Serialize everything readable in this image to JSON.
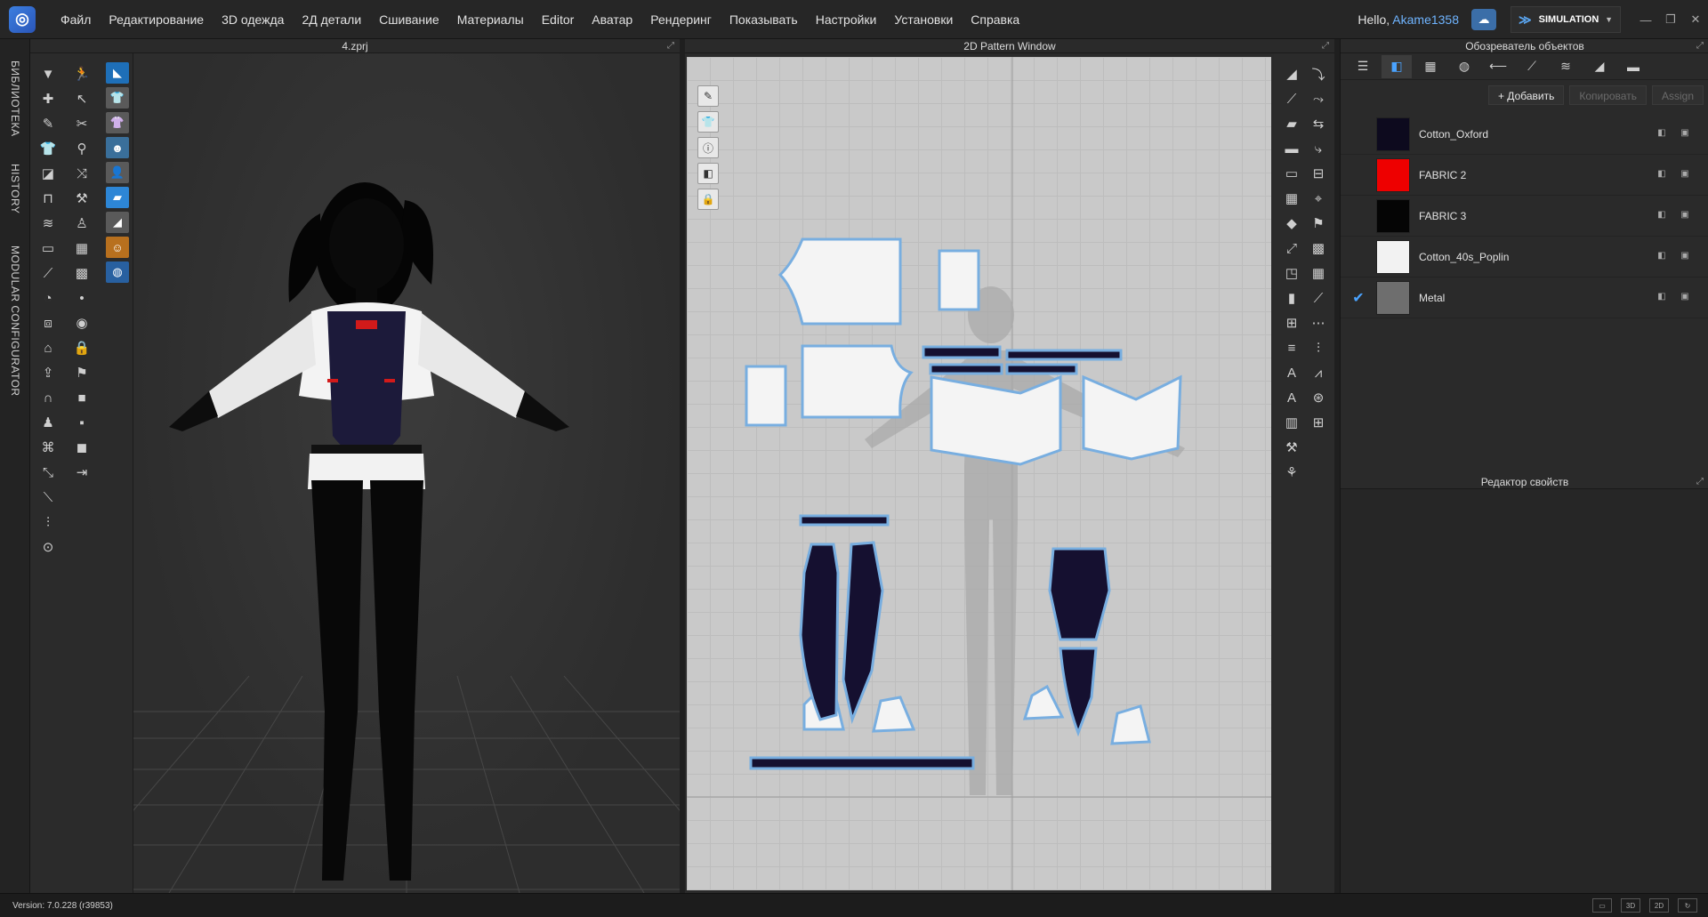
{
  "app": {
    "logo": "CLO logo"
  },
  "menu": {
    "items": [
      "Файл",
      "Редактирование",
      "3D одежда",
      "2Д детали",
      "Сшивание",
      "Материалы",
      "Editor",
      "Аватар",
      "Рендеринг",
      "Показывать",
      "Настройки",
      "Установки",
      "Справка"
    ]
  },
  "account": {
    "greeting": "Hello, ",
    "username": "Akame1358",
    "mode": "SIMULATION"
  },
  "side_tabs": {
    "library": "БИБЛИОТЕКА",
    "history": "HISTORY",
    "modular": "MODULAR CONFIGURATOR"
  },
  "window3d": {
    "title": "4.zprj"
  },
  "window2d": {
    "title": "2D Pattern Window"
  },
  "object_browser": {
    "title": "Обозреватель объектов",
    "add_button": "+ Добавить",
    "copy_button": "Копировать",
    "assign_button": "Assign",
    "fabrics": [
      {
        "name": "Cotton_Oxford",
        "color": "#0d0a1e",
        "selected": false
      },
      {
        "name": "FABRIC 2",
        "color": "#ee0000",
        "selected": false
      },
      {
        "name": "FABRIC 3",
        "color": "#050505",
        "selected": false
      },
      {
        "name": "Cotton_40s_Poplin",
        "color": "#f2f2f2",
        "selected": false
      },
      {
        "name": "Metal",
        "color": "#6e6e6e",
        "selected": true
      }
    ]
  },
  "property_editor": {
    "title": "Редактор свойств"
  },
  "status": {
    "version": "Version: 7.0.228 (r39853)"
  },
  "colors": {
    "accent": "#4aa3ff",
    "menubar": "#262626",
    "pattern_bg": "#c9c9c9",
    "pattern_outline": "#78aee0",
    "dark_fabric": "#151030"
  }
}
